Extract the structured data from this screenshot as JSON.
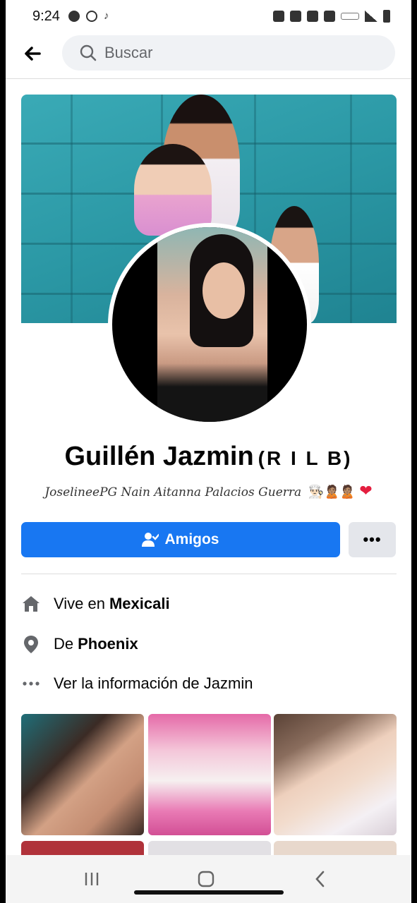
{
  "status_bar": {
    "time": "9:24"
  },
  "search": {
    "placeholder": "Buscar"
  },
  "profile": {
    "name": "Guillén Jazmin",
    "name_suffix": "(R I L B)",
    "bio": "JoselineePG Nain Aitanna Palacios Guerra",
    "bio_emojis": "👨🏻‍🍳🙎🏽🙎🏽",
    "bio_heart": "❤"
  },
  "actions": {
    "friends_label": "Amigos",
    "more_label": "•••"
  },
  "info": [
    {
      "icon": "home-icon",
      "prefix": "Vive en",
      "bold": "Mexicali"
    },
    {
      "icon": "location-pin-icon",
      "prefix": "De",
      "bold": "Phoenix"
    },
    {
      "icon": "more-dots-icon",
      "prefix": "Ver la información de Jazmin",
      "bold": ""
    }
  ],
  "colors": {
    "primary": "#1877f2",
    "secondary_btn": "#e4e6eb",
    "search_bg": "#f0f2f5"
  }
}
